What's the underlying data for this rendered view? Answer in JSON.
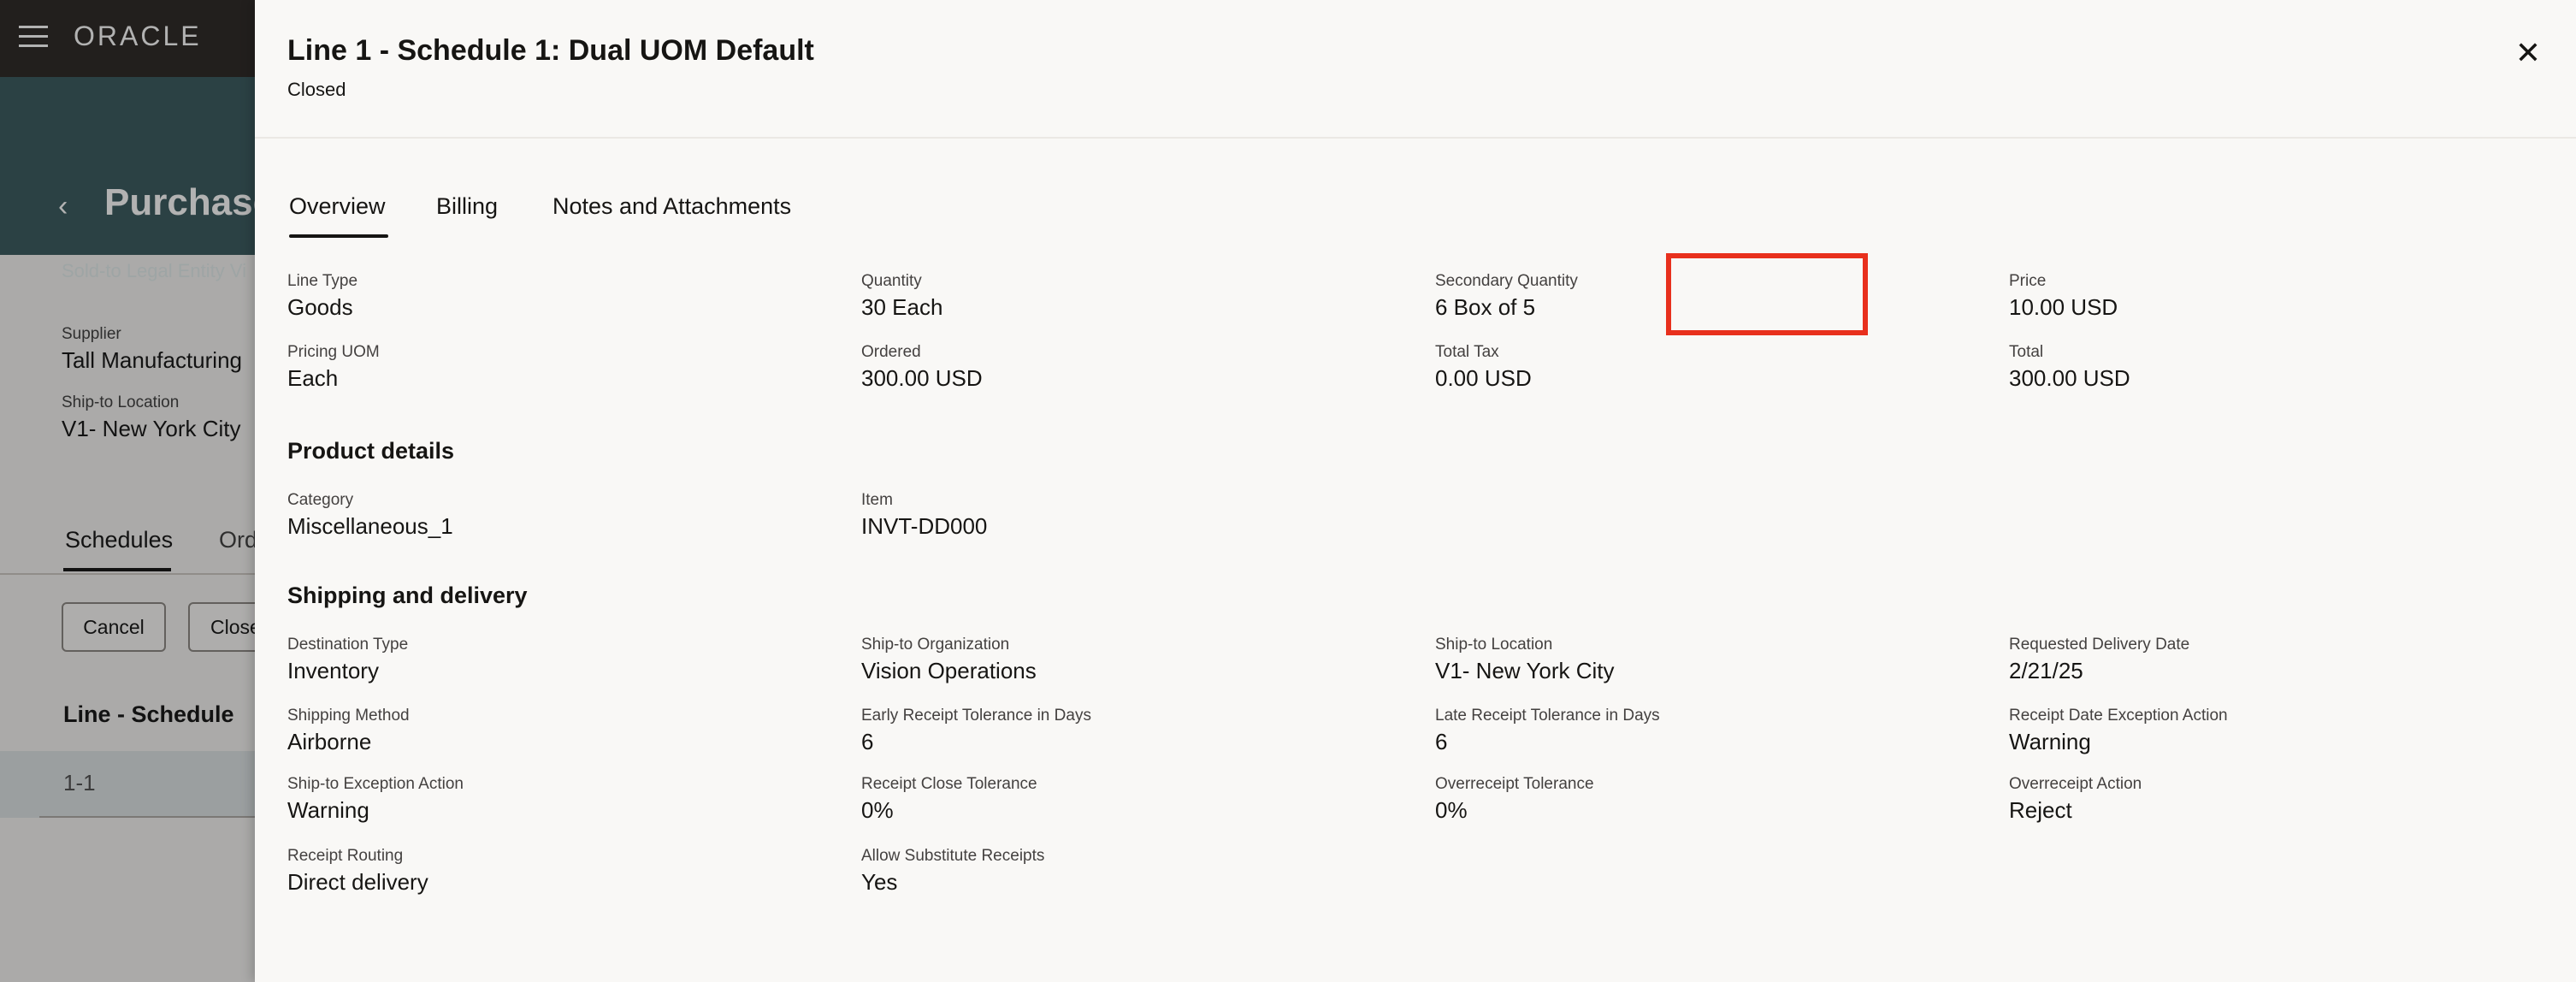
{
  "background": {
    "brand": "ORACLE",
    "page_title": "Purchase",
    "subtitle_partial": "Sold-to Legal Entity  Vi",
    "supplier_label": "Supplier",
    "supplier_value": "Tall Manufacturing",
    "ship_to_label": "Ship-to Location",
    "ship_to_value": "V1- New York City",
    "tabs": [
      "Schedules",
      "Ord"
    ],
    "buttons": [
      "Cancel",
      "Close"
    ],
    "section": "Line - Schedule",
    "row": "1-1"
  },
  "drawer": {
    "title": "Line 1 - Schedule 1: Dual UOM Default",
    "status": "Closed",
    "close_icon": "close-icon",
    "tabs": [
      "Overview",
      "Billing",
      "Notes and Attachments"
    ],
    "overview": {
      "line_type_label": "Line Type",
      "line_type": "Goods",
      "quantity_label": "Quantity",
      "quantity": "30 Each",
      "secondary_quantity_label": "Secondary Quantity",
      "secondary_quantity": "6 Box of 5",
      "price_label": "Price",
      "price": "10.00 USD",
      "pricing_uom_label": "Pricing UOM",
      "pricing_uom": "Each",
      "ordered_label": "Ordered",
      "ordered": "300.00 USD",
      "total_tax_label": "Total Tax",
      "total_tax": "0.00 USD",
      "total_label": "Total",
      "total": "300.00 USD"
    },
    "product_details": {
      "title": "Product details",
      "category_label": "Category",
      "category": "Miscellaneous_1",
      "item_label": "Item",
      "item": "INVT-DD000"
    },
    "shipping": {
      "title": "Shipping and delivery",
      "destination_type_label": "Destination Type",
      "destination_type": "Inventory",
      "ship_to_org_label": "Ship-to Organization",
      "ship_to_org": "Vision Operations",
      "ship_to_location_label": "Ship-to Location",
      "ship_to_location": "V1- New York City",
      "requested_delivery_label": "Requested Delivery Date",
      "requested_delivery": "2/21/25",
      "shipping_method_label": "Shipping Method",
      "shipping_method": "Airborne",
      "early_receipt_label": "Early Receipt Tolerance in Days",
      "early_receipt": "6",
      "late_receipt_label": "Late Receipt Tolerance in Days",
      "late_receipt": "6",
      "receipt_date_exception_label": "Receipt Date Exception Action",
      "receipt_date_exception": "Warning",
      "ship_to_exception_label": "Ship-to Exception Action",
      "ship_to_exception": "Warning",
      "receipt_close_label": "Receipt Close Tolerance",
      "receipt_close": "0%",
      "overreceipt_tol_label": "Overreceipt Tolerance",
      "overreceipt_tol": "0%",
      "overreceipt_action_label": "Overreceipt Action",
      "overreceipt_action": "Reject",
      "receipt_routing_label": "Receipt Routing",
      "receipt_routing": "Direct delivery",
      "allow_substitute_label": "Allow Substitute Receipts",
      "allow_substitute": "Yes"
    }
  },
  "colors": {
    "highlight": "#e8301d",
    "topbar": "#312d2a",
    "hero": "#3e5d62"
  }
}
